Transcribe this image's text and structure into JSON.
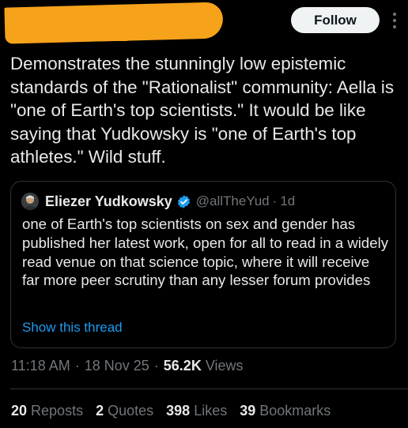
{
  "header": {
    "follow_label": "Follow",
    "more_icon": "more-vertical-icon"
  },
  "tweet": {
    "text": "Demonstrates the stunningly low epistemic standards of the \"Rationalist\" community: Aella is \"one of Earth's top scientists.\" It would be like saying that Yudkowsky is \"one of Earth's top athletes.\" Wild stuff."
  },
  "quote": {
    "name": "Eliezer Yudkowsky",
    "handle": "@allTheYud",
    "separator": "·",
    "time": "1d",
    "text": "one of Earth's top scientists on sex and gender has published her latest work, open for all to read in a widely read venue on that science topic, where it will receive far more peer scrutiny than any lesser forum provides",
    "show_thread": "Show this thread"
  },
  "meta": {
    "time": "11:18 AM",
    "date": "18 Nov 25",
    "separator": "·",
    "views_count": "56.2K",
    "views_label": "Views"
  },
  "stats": [
    {
      "num": "20",
      "label": "Reposts"
    },
    {
      "num": "2",
      "label": "Quotes"
    },
    {
      "num": "398",
      "label": "Likes"
    },
    {
      "num": "39",
      "label": "Bookmarks"
    }
  ],
  "colors": {
    "background": "#000000",
    "text": "#e7e9ea",
    "secondary": "#71767b",
    "link": "#1d9bf0",
    "border": "#2f3336",
    "redaction": "#f7a21b",
    "verified": "#1d9bf0"
  }
}
